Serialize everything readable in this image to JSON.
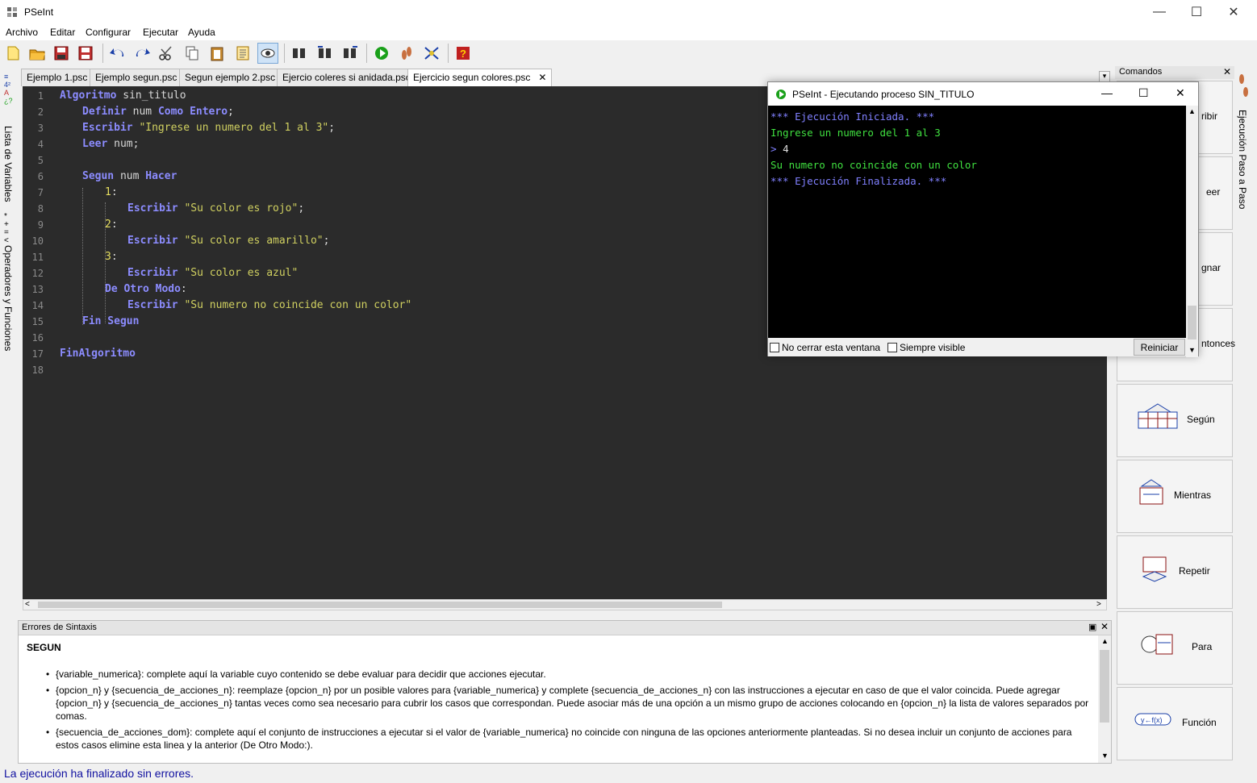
{
  "window": {
    "title": "PSeInt"
  },
  "menu": [
    "Archivo",
    "Editar",
    "Configurar",
    "Ejecutar",
    "Ayuda"
  ],
  "tabs": [
    {
      "label": "Ejemplo 1.psc"
    },
    {
      "label": "Ejemplo segun.psc"
    },
    {
      "label": "Segun ejemplo 2.psc"
    },
    {
      "label": "Ejercio coleres si anidada.psc"
    },
    {
      "label": "Ejercicio segun colores.psc",
      "close": "✕"
    }
  ],
  "left_sidebar": {
    "variables": "Lista de Variables",
    "operators": "Operadores y Funciones"
  },
  "right_sidebar": {
    "step": "Ejecución Paso a Paso"
  },
  "editor": {
    "lines": [
      [
        "1",
        "2",
        "3",
        "4",
        "5",
        "6",
        "7",
        "8",
        "9",
        "10",
        "11",
        "12",
        "13",
        "14",
        "15",
        "16",
        "17",
        "18"
      ]
    ],
    "code": {
      "l1_kw": "Algoritmo",
      "l1_rest": " sin_titulo",
      "l2_kw1": "Definir",
      "l2_mid": " num ",
      "l2_kw2": "Como Entero",
      "l2_end": ";",
      "l3_kw": "Escribir",
      "l3_str": " \"Ingrese un numero del 1 al 3\"",
      "l3_end": ";",
      "l4_kw": "Leer",
      "l4_rest": " num;",
      "l6_kw1": "Segun",
      "l6_mid": " num ",
      "l6_kw2": "Hacer",
      "l7_num": "1",
      "l7_end": ":",
      "l8_kw": "Escribir",
      "l8_str": " \"Su color es rojo\"",
      "l8_end": ";",
      "l9_num": "2",
      "l9_end": ":",
      "l10_kw": "Escribir",
      "l10_str": " \"Su color es amarillo\"",
      "l10_end": ";",
      "l11_num": "3",
      "l11_end": ":",
      "l12_kw": "Escribir",
      "l12_str": " \"Su color es azul\"",
      "l13_kw": "De Otro Modo",
      "l13_end": ":",
      "l14_kw": "Escribir",
      "l14_str": " \"Su numero no coincide con un color\"",
      "l15_kw": "Fin Segun",
      "l17_kw": "FinAlgoritmo"
    }
  },
  "errors_panel": {
    "title": "Errores de Sintaxis",
    "heading": "SEGUN",
    "items": [
      "{variable_numerica}: complete aquí la variable cuyo contenido se debe evaluar para decidir que acciones ejecutar.",
      "{opcion_n} y {secuencia_de_acciones_n}: reemplaze {opcion_n} por un posible valores para {variable_numerica} y complete {secuencia_de_acciones_n} con las instrucciones a ejecutar en caso de que el valor coincida. Puede agregar {opcion_n} y {secuencia_de_acciones_n} tantas veces como sea necesario para cubrir los casos que correspondan. Puede asociar más de una opción a un mismo grupo de acciones colocando en {opcion_n} la lista de valores separados por comas.",
      "{secuencia_de_acciones_dom}: complete aquí el conjunto de instrucciones a ejecutar si el valor de {variable_numerica} no coincide con ninguna de las opciones anteriormente planteadas. Si no desea incluir un conjunto de acciones para estos casos elimine esta linea y la anterior (De Otro Modo:)."
    ]
  },
  "status": "La ejecución ha finalizado sin errores.",
  "commands_panel": {
    "title": "Comandos",
    "buttons": [
      "ribir",
      "eer",
      "gnar",
      "ntonces",
      "Según",
      "Mientras",
      "Repetir",
      "Para",
      "Función"
    ]
  },
  "exec_window": {
    "title": "PSeInt - Ejecutando proceso SIN_TITULO",
    "console": [
      "*** Ejecución Iniciada. ***",
      "Ingrese un numero del 1 al 3",
      "> 4",
      "Su numero no coincide con un color",
      "*** Ejecución Finalizada. ***"
    ],
    "no_close": "No cerrar esta ventana",
    "always_visible": "Siempre visible",
    "restart": "Reiniciar"
  }
}
